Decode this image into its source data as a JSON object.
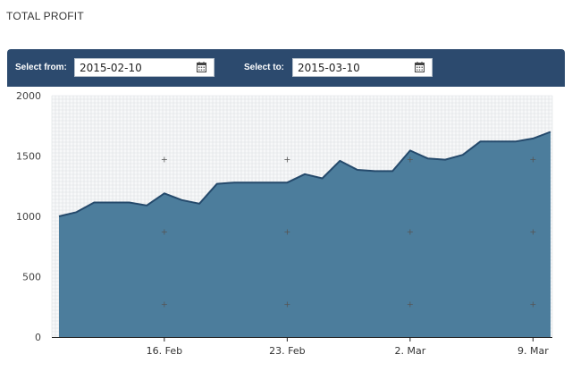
{
  "page": {
    "title": "TOTAL PROFIT"
  },
  "filters": {
    "from_label": "Select from:",
    "from_value": "2015-02-10",
    "to_label": "Select to:",
    "to_value": "2015-03-10",
    "calendar_icon": "calendar-icon"
  },
  "colors": {
    "toolbar": "#2c4a6e",
    "area_fill": "#4c7d9c",
    "area_line": "#254a6c"
  },
  "chart_data": {
    "type": "area",
    "x": [
      "2015-02-10",
      "2015-02-11",
      "2015-02-12",
      "2015-02-13",
      "2015-02-14",
      "2015-02-15",
      "2015-02-16",
      "2015-02-17",
      "2015-02-18",
      "2015-02-19",
      "2015-02-20",
      "2015-02-21",
      "2015-02-22",
      "2015-02-23",
      "2015-02-24",
      "2015-02-25",
      "2015-02-26",
      "2015-02-27",
      "2015-02-28",
      "2015-03-01",
      "2015-03-02",
      "2015-03-03",
      "2015-03-04",
      "2015-03-05",
      "2015-03-06",
      "2015-03-07",
      "2015-03-08",
      "2015-03-09",
      "2015-03-10"
    ],
    "series": [
      {
        "values": [
          1000,
          1035,
          1115,
          1115,
          1115,
          1090,
          1190,
          1135,
          1105,
          1270,
          1280,
          1280,
          1280,
          1280,
          1350,
          1315,
          1460,
          1385,
          1375,
          1375,
          1545,
          1480,
          1470,
          1510,
          1620,
          1620,
          1620,
          1645,
          1700
        ]
      }
    ],
    "ylim": [
      0,
      2000
    ],
    "yticks": [
      0,
      500,
      1000,
      1500,
      2000
    ],
    "xticks": [
      {
        "x": "2015-02-16",
        "label": "16. Feb"
      },
      {
        "x": "2015-02-23",
        "label": "23. Feb"
      },
      {
        "x": "2015-03-02",
        "label": "2. Mar"
      },
      {
        "x": "2015-03-09",
        "label": "9. Mar"
      }
    ],
    "grid": true,
    "legend": "none"
  }
}
